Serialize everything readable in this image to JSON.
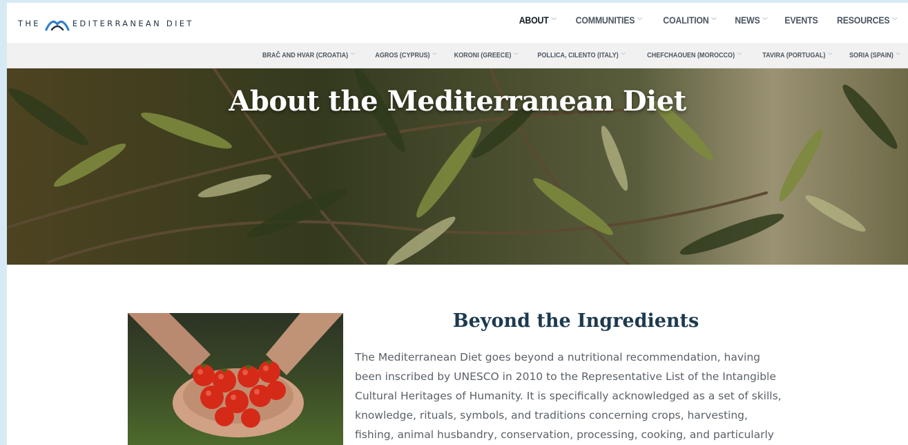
{
  "header": {
    "logo_text_left": "THE",
    "logo_text_right": "EDITERRANEAN DIET",
    "menu": [
      {
        "label": "ABOUT",
        "active": true,
        "has_dropdown": true
      },
      {
        "label": "COMMUNITIES",
        "active": false,
        "has_dropdown": true
      },
      {
        "label": "COALITION",
        "active": false,
        "has_dropdown": true
      },
      {
        "label": "NEWS",
        "active": false,
        "has_dropdown": true
      },
      {
        "label": "EVENTS",
        "active": false,
        "has_dropdown": false
      },
      {
        "label": "RESOURCES",
        "active": false,
        "has_dropdown": true
      }
    ]
  },
  "subnav": {
    "items": [
      "BRAČ AND HVAR (CROATIA)",
      "AGROS (CYPRUS)",
      "KORONI (GREECE)",
      "POLLICA, CILENTO (ITALY)",
      "CHEFCHAOUEN (MOROCCO)",
      "TAVIRA (PORTUGAL)",
      "SORIA (SPAIN)"
    ]
  },
  "hero": {
    "title": "About the Mediterranean Diet",
    "image": "olive-branches"
  },
  "section": {
    "image": "hands-holding-tomatoes",
    "heading": "Beyond the Ingredients",
    "body_lines": [
      "The Mediterranean Diet goes beyond a nutritional recommendation, having",
      "been inscribed by UNESCO in 2010 to the Representative List of the Intangible",
      "Cultural Heritages of Humanity. It is specifically acknowledged as a set of skills,",
      "knowledge, rituals, symbols, and traditions concerning crops, harvesting,",
      "fishing, animal husbandry, conservation, processing, cooking, and particularly"
    ]
  },
  "colors": {
    "logo_accent": "#2f7ec9",
    "heading": "#1d3a4f",
    "page_background": "#d6eaf5"
  }
}
